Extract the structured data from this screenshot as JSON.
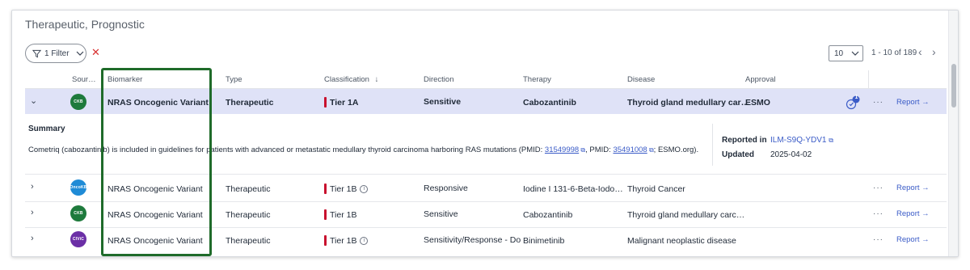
{
  "panel": {
    "title": "Therapeutic, Prognostic"
  },
  "toolbar": {
    "filter_label": "1 Filter",
    "page_size": "10",
    "range": "1 - 10 of 189",
    "prev": "‹",
    "next": "›"
  },
  "columns": {
    "source": "Sour…",
    "biomarker": "Biomarker",
    "type": "Type",
    "classification": "Classification",
    "direction": "Direction",
    "therapy": "Therapy",
    "disease": "Disease",
    "approval": "Approval"
  },
  "rows": [
    {
      "source": "CKB",
      "source_color": "#1e7a3c",
      "biomarker": "NRAS Oncogenic Variant",
      "type": "Therapeutic",
      "tier": "Tier 1A",
      "direction": "Sensitive",
      "therapy": "Cabozantinib",
      "disease": "Thyroid gland medullary car…",
      "approval": "ESMO",
      "approval_badge": "1",
      "report": "Report →",
      "more": "···"
    },
    {
      "source": "OncoKB",
      "source_color": "#1f8bd6",
      "biomarker": "NRAS Oncogenic Variant",
      "type": "Therapeutic",
      "tier": "Tier 1B",
      "direction": "Responsive",
      "therapy": "Iodine I 131-6-Beta-Iodo…",
      "disease": "Thyroid Cancer",
      "approval": "",
      "report": "Report →",
      "more": "···"
    },
    {
      "source": "CKB",
      "source_color": "#1e7a3c",
      "biomarker": "NRAS Oncogenic Variant",
      "type": "Therapeutic",
      "tier": "Tier 1B",
      "direction": "Sensitive",
      "therapy": "Cabozantinib",
      "disease": "Thyroid gland medullary carc…",
      "approval": "",
      "report": "Report →",
      "more": "···"
    },
    {
      "source": "CIViC",
      "source_color": "#6b2fa6",
      "biomarker": "NRAS Oncogenic Variant",
      "type": "Therapeutic",
      "tier": "Tier 1B",
      "direction": "Sensitivity/Response - Do",
      "therapy": "Binimetinib",
      "disease": "Malignant neoplastic disease",
      "approval": "",
      "report": "Report →",
      "more": "···"
    }
  ],
  "detail": {
    "summary_title": "Summary",
    "summary_text_1": "Cometriq (cabozantinib) is included in guidelines for patients with advanced or metastatic medullary thyroid carcinoma harboring RAS mutations (PMID: ",
    "pmid_1": "31549998",
    "summary_text_2": ", PMID: ",
    "pmid_2": "35491008",
    "summary_text_3": "; ESMO.org).",
    "reported_in_label": "Reported in",
    "reported_in_value": "ILM-S9Q-YDV1",
    "updated_label": "Updated",
    "updated_value": "2025-04-02"
  },
  "colors": {
    "accent": "#3a5bc7",
    "tier_red": "#c8102e",
    "highlight": "#1f6b2a",
    "selected_row": "#dfe2f7"
  }
}
